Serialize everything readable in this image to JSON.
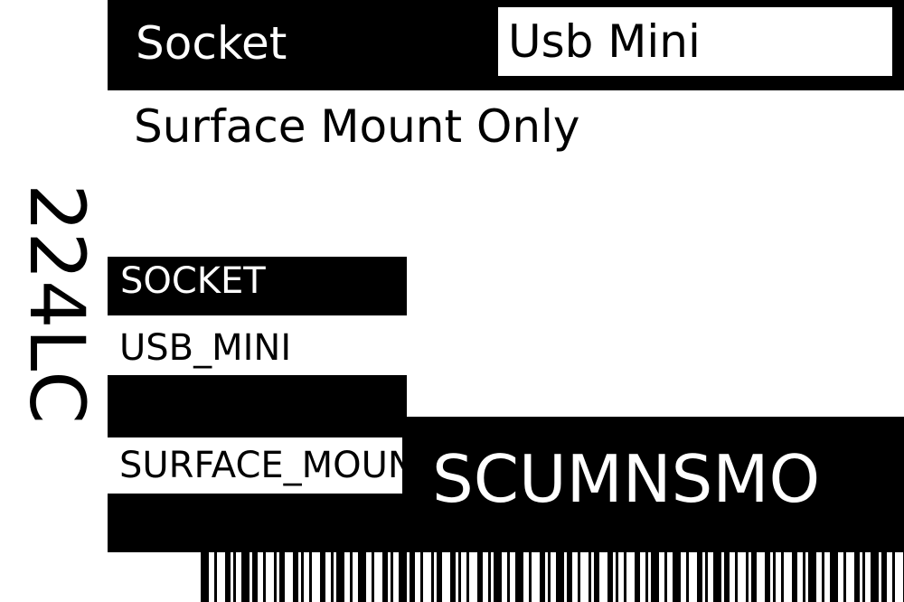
{
  "header": {
    "label": "Socket",
    "value": "Usb Mini"
  },
  "subtitle": "Surface Mount Only",
  "side_code": "224LC",
  "tags": {
    "socket": "SOCKET",
    "usb": "USB_MINI",
    "surface": "SURFACE_MOUNT_ONLY"
  },
  "code": "SCUMNSMO",
  "colors": {
    "foreground": "#000000",
    "background": "#ffffff"
  }
}
